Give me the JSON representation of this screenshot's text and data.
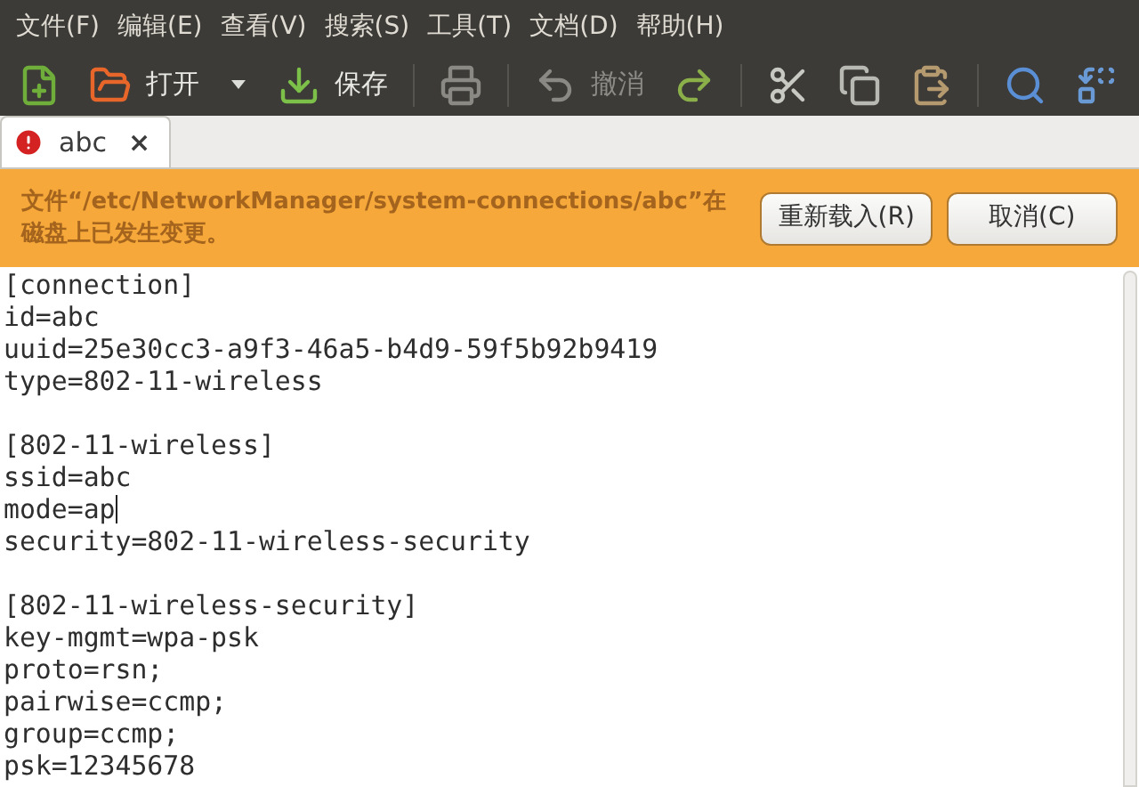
{
  "menu": [
    "文件(F)",
    "编辑(E)",
    "查看(V)",
    "搜索(S)",
    "工具(T)",
    "文档(D)",
    "帮助(H)"
  ],
  "toolbar": [
    {
      "kind": "new",
      "disabled": false
    },
    {
      "kind": "open",
      "label": "打开",
      "disabled": false
    },
    {
      "kind": "dropdown",
      "disabled": false
    },
    {
      "kind": "save",
      "label": "保存",
      "disabled": false
    },
    {
      "kind": "print",
      "disabled": true
    },
    {
      "kind": "undo",
      "label": "撤消",
      "disabled": true
    },
    {
      "kind": "redo",
      "disabled": false
    },
    {
      "kind": "cut",
      "disabled": false
    },
    {
      "kind": "copy",
      "disabled": false
    },
    {
      "kind": "paste",
      "disabled": false
    },
    {
      "kind": "search",
      "disabled": false
    },
    {
      "kind": "replace",
      "disabled": false
    }
  ],
  "tabs": [
    {
      "label": "abc",
      "close": "×",
      "selected": true,
      "warning": true
    }
  ],
  "infobar": {
    "message": "文件“/etc/NetworkManager/system-connections/abc”在磁盘上已发生变更。",
    "buttons": [
      "重新载入(R)",
      "取消(C)"
    ]
  },
  "editor": {
    "sections": [
      {
        "lines": [
          {
            "text": "[connection]",
            "cursor": false
          },
          {
            "text": "id=abc",
            "cursor": false
          },
          {
            "text": "uuid=25e30cc3-a9f3-46a5-b4d9-59f5b92b9419",
            "cursor": false
          },
          {
            "text": "type=802-11-wireless",
            "cursor": false
          }
        ]
      },
      {
        "lines": [
          {
            "text": "[802-11-wireless]",
            "cursor": false
          },
          {
            "text": "ssid=abc",
            "cursor": false
          },
          {
            "text": "mode=ap",
            "cursor": true
          },
          {
            "text": "security=802-11-wireless-security",
            "cursor": false
          }
        ]
      },
      {
        "lines": [
          {
            "text": "[802-11-wireless-security]",
            "cursor": false
          },
          {
            "text": "key-mgmt=wpa-psk",
            "cursor": false
          },
          {
            "text": "proto=rsn;",
            "cursor": false
          },
          {
            "text": "pairwise=ccmp;",
            "cursor": false
          },
          {
            "text": "group=ccmp;",
            "cursor": false
          },
          {
            "text": "psk=12345678",
            "cursor": false
          }
        ]
      }
    ]
  }
}
